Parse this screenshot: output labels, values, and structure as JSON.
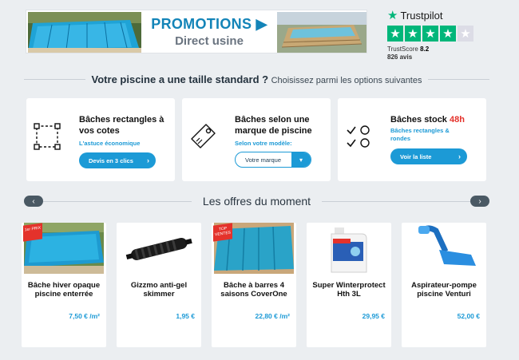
{
  "promo": {
    "title": "PROMOTIONS ▶",
    "subtitle": "Direct usine"
  },
  "trustpilot": {
    "brand": "Trustpilot",
    "trustscore_label": "TrustScore",
    "trustscore": "8.2",
    "reviews": "826 avis",
    "stars_filled": 4,
    "stars_total": 5
  },
  "section1": {
    "title": "Votre piscine a une taille standard ?",
    "subtitle": "Choisissez parmi les options suivantes"
  },
  "options": [
    {
      "title": "Bâches rectangles à vos cotes",
      "hint": "L'astuce économique",
      "button": "Devis en 3 clics"
    },
    {
      "title": "Bâches selon une marque de piscine",
      "hint": "Selon votre modèle:",
      "select": "Votre marque"
    },
    {
      "title": "Bâches stock ",
      "title_accent": "48h",
      "hint": "Bâches rectangles & rondes",
      "button": "Voir la liste"
    }
  ],
  "offers": {
    "title": "Les offres du moment",
    "products": [
      {
        "name": "Bâche hiver opaque piscine enterrée",
        "price": "7,50 € /m²",
        "ribbon": "1er PRIX"
      },
      {
        "name": "Gizzmo anti-gel skimmer",
        "price": "1,95 €"
      },
      {
        "name": "Bâche à barres 4 saisons CoverOne",
        "price": "22,80 € /m²",
        "ribbon": "TOP VENTES"
      },
      {
        "name": "Super Winterprotect Hth 3L",
        "price": "29,95 €"
      },
      {
        "name": "Aspirateur-pompe piscine Venturi",
        "price": "52,00 €"
      }
    ]
  },
  "colors": {
    "accent": "#1c9ad6",
    "trustpilot_green": "#00b67a",
    "sale_red": "#e4322b",
    "page_bg": "#ebeef1"
  }
}
